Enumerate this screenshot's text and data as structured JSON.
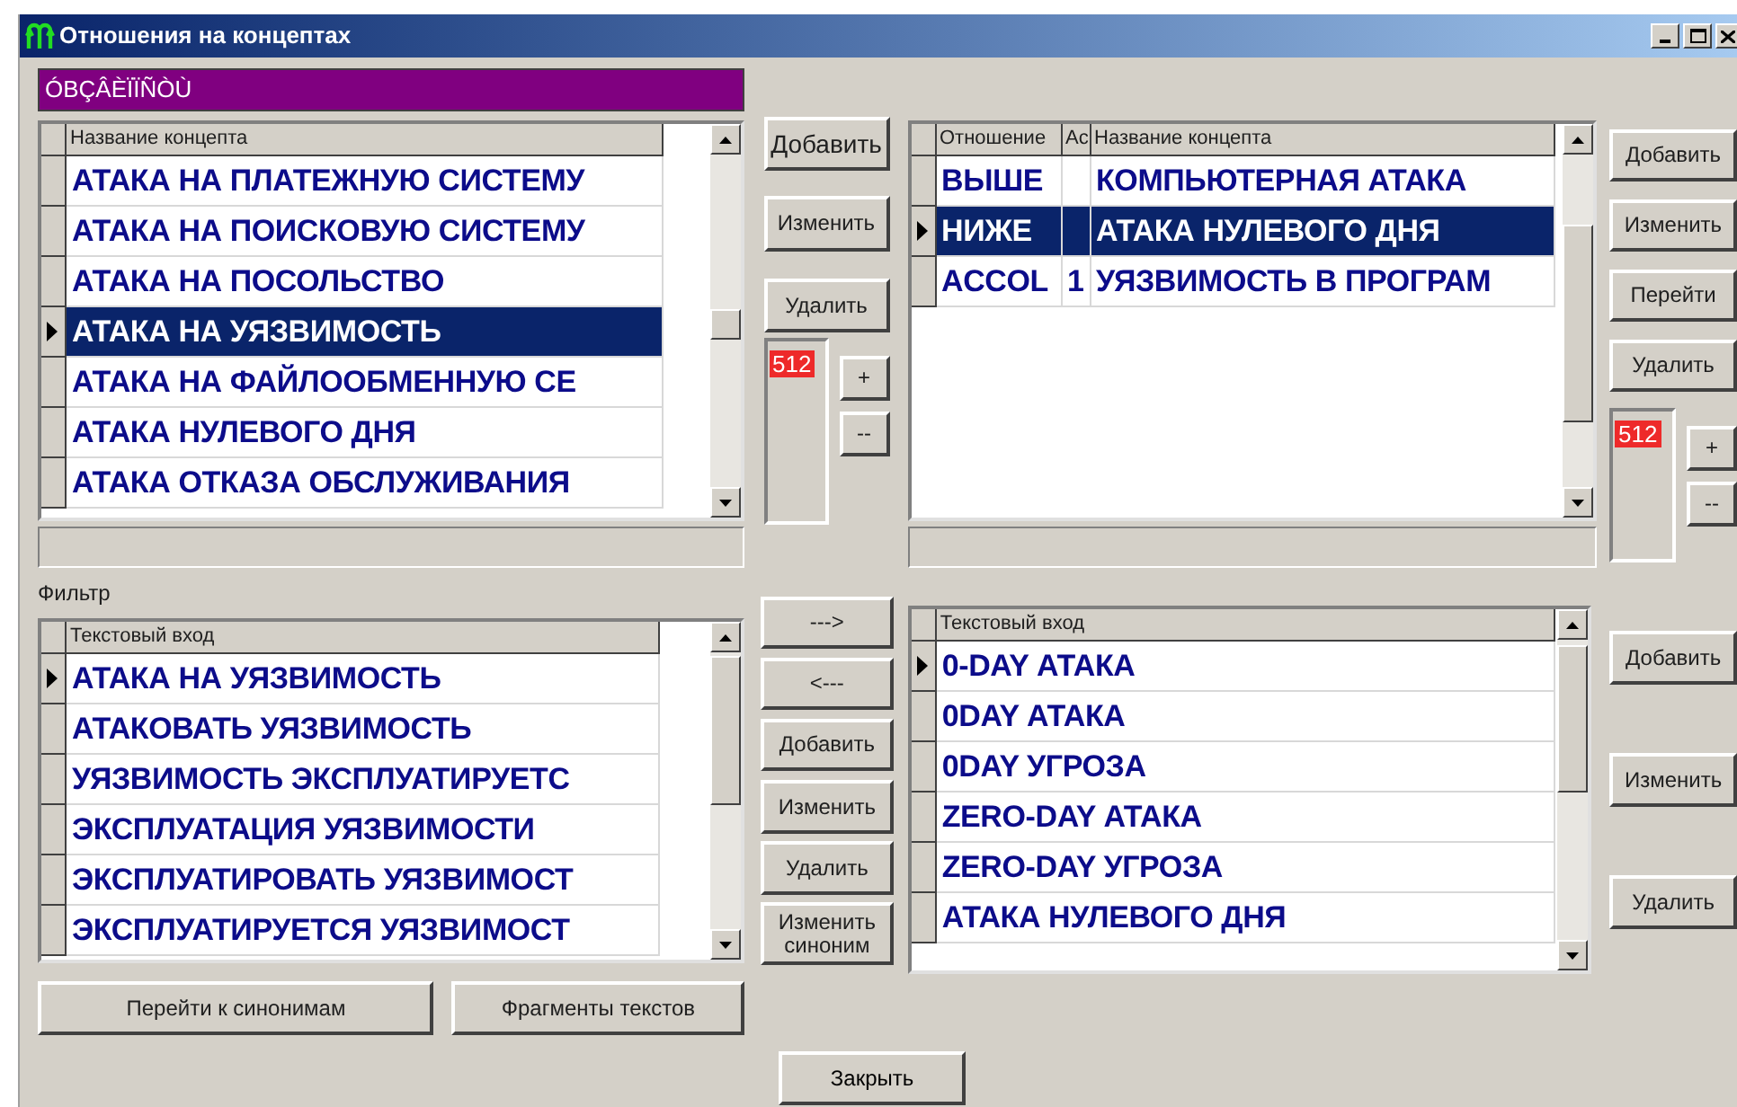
{
  "window": {
    "title": "Отношения на концептах"
  },
  "header_bar": {
    "text": "ÓBÇÂÈÏÏÑÒÙ"
  },
  "concepts": {
    "columns": [
      "Название концепта"
    ],
    "rows": [
      {
        "cells": [
          "АТАКА НА ПЛАТЕЖНУЮ СИСТЕМУ"
        ],
        "current": false,
        "selected": false
      },
      {
        "cells": [
          "АТАКА НА ПОИСКОВУЮ СИСТЕМУ"
        ],
        "current": false,
        "selected": false
      },
      {
        "cells": [
          "АТАКА НА ПОСОЛЬСТВО"
        ],
        "current": false,
        "selected": false
      },
      {
        "cells": [
          "АТАКА НА УЯЗВИМОСТЬ"
        ],
        "current": true,
        "selected": true
      },
      {
        "cells": [
          "АТАКА НА ФАЙЛООБМЕННУЮ СЕ"
        ],
        "current": false,
        "selected": false
      },
      {
        "cells": [
          "АТАКА НУЛЕВОГО ДНЯ"
        ],
        "current": false,
        "selected": false
      },
      {
        "cells": [
          "АТАКА ОТКАЗА ОБСЛУЖИВАНИЯ"
        ],
        "current": false,
        "selected": false
      }
    ]
  },
  "concept_buttons": [
    "Добавить",
    "Изменить",
    "Удалить"
  ],
  "concept_counter": {
    "value": "512",
    "buttons": [
      "+",
      "--"
    ]
  },
  "relations": {
    "columns": [
      "Отношение",
      "Ac",
      "Название концепта"
    ],
    "rows": [
      {
        "cells": [
          "ВЫШЕ",
          "",
          "КОМПЬЮТЕРНАЯ АТАКА"
        ],
        "current": false,
        "selected": false
      },
      {
        "cells": [
          "НИЖЕ",
          "",
          "АТАКА НУЛЕВОГО ДНЯ"
        ],
        "current": true,
        "selected": true
      },
      {
        "cells": [
          "ACCOL",
          "1",
          "УЯЗВИМОСТЬ В ПРОГРАМ"
        ],
        "current": false,
        "selected": false
      }
    ]
  },
  "relation_buttons": [
    "Добавить",
    "Изменить",
    "Перейти",
    "Удалить"
  ],
  "relation_counter": {
    "value": "512",
    "buttons": [
      "+",
      "--"
    ]
  },
  "filter_label": "Фильтр",
  "text_inputs": {
    "columns": [
      "Текстовый вход"
    ],
    "rows": [
      {
        "cells": [
          "АТАКА НА УЯЗВИМОСТЬ"
        ],
        "current": true
      },
      {
        "cells": [
          "АТАКОВАТЬ УЯЗВИМОСТЬ"
        ],
        "current": false
      },
      {
        "cells": [
          "УЯЗВИМОСТЬ ЭКСПЛУАТИРУЕТС"
        ],
        "current": false
      },
      {
        "cells": [
          "ЭКСПЛУАТАЦИЯ УЯЗВИМОСТИ"
        ],
        "current": false
      },
      {
        "cells": [
          "ЭКСПЛУАТИРОВАТЬ УЯЗВИМОСТ"
        ],
        "current": false
      },
      {
        "cells": [
          "ЭКСПЛУАТИРУЕТСЯ УЯЗВИМОСТ"
        ],
        "current": false
      }
    ]
  },
  "transfer_buttons": [
    "--->",
    "<---",
    "Добавить",
    "Изменить",
    "Удалить",
    "Изменить синоним"
  ],
  "synonyms": {
    "columns": [
      "Текстовый вход"
    ],
    "rows": [
      {
        "cells": [
          "0-DAY АТАКА"
        ],
        "current": true
      },
      {
        "cells": [
          "0DAY АТАКА"
        ],
        "current": false
      },
      {
        "cells": [
          "0DAY УГРОЗА"
        ],
        "current": false
      },
      {
        "cells": [
          "ZERO-DAY АТАКА"
        ],
        "current": false
      },
      {
        "cells": [
          "ZERO-DAY УГРОЗА"
        ],
        "current": false
      },
      {
        "cells": [
          "АТАКА НУЛЕВОГО ДНЯ"
        ],
        "current": false
      }
    ]
  },
  "synonym_buttons": [
    "Добавить",
    "Изменить",
    "Удалить"
  ],
  "bottom_buttons": [
    "Перейти к синонимам",
    "Фрагменты текстов"
  ],
  "close_button": "Закрыть"
}
